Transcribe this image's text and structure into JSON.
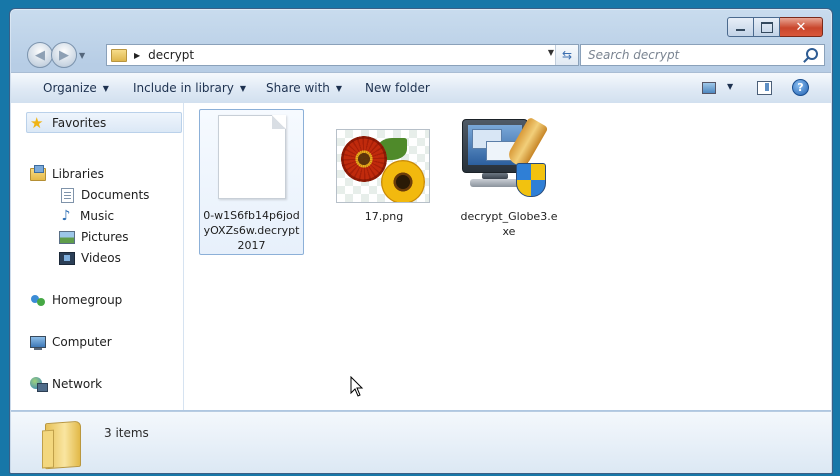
{
  "window": {
    "address_path": "decrypt",
    "search_placeholder": "Search decrypt"
  },
  "toolbar": {
    "organize": "Organize",
    "include_in_library": "Include in library",
    "share_with": "Share with",
    "new_folder": "New folder"
  },
  "nav": {
    "favorites": "Favorites",
    "libraries": "Libraries",
    "documents": "Documents",
    "music": "Music",
    "pictures": "Pictures",
    "videos": "Videos",
    "homegroup": "Homegroup",
    "computer": "Computer",
    "network": "Network"
  },
  "files": [
    {
      "name_line1": "0-w1S6fb14p6jod",
      "name_line2": "yOXZs6w.decrypt",
      "name_line3": "2017"
    },
    {
      "name_line1": "17.png"
    },
    {
      "name_line1": "decrypt_Globe3.e",
      "name_line2": "xe"
    }
  ],
  "details": {
    "item_count": "3 items"
  },
  "colors": {
    "desktop": "#1777a8",
    "selection_border": "#8cb0d8",
    "close_button": "#c9462c"
  }
}
